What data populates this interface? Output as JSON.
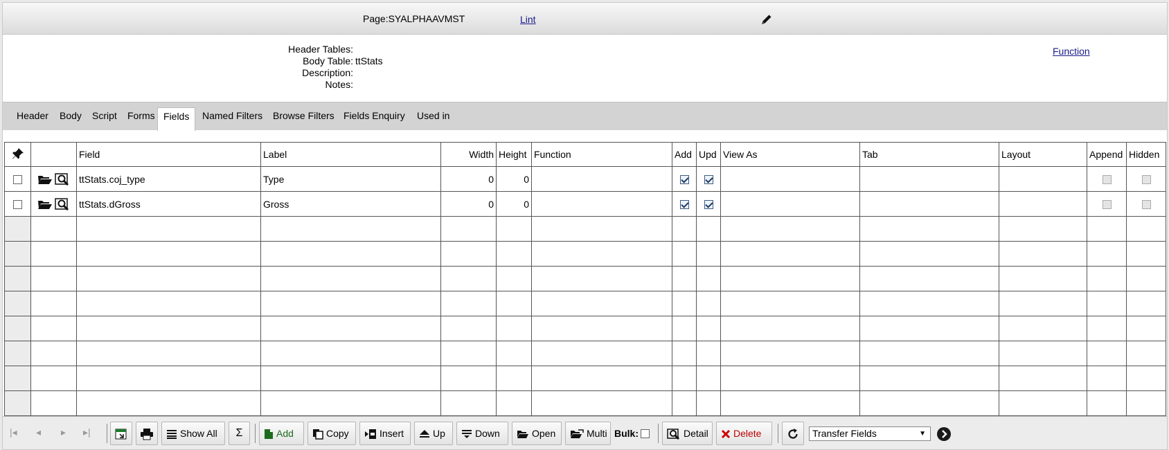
{
  "topbar": {
    "page_label": "Page:SYALPHAAVMST",
    "lint_label": "Lint",
    "edit_icon": "pencil-icon"
  },
  "info": {
    "header_tables_label": "Header Tables:",
    "header_tables_value": "",
    "body_table_label": "Body Table:",
    "body_table_value": "ttStats",
    "description_label": "Description:",
    "description_value": "",
    "notes_label": "Notes:",
    "notes_value": "",
    "function_link": "Function"
  },
  "tabs": [
    {
      "label": "Header"
    },
    {
      "label": "Body"
    },
    {
      "label": "Script"
    },
    {
      "label": "Forms"
    },
    {
      "label": "Fields",
      "active": true
    },
    {
      "label": "Named Filters"
    },
    {
      "label": "Browse Filters"
    },
    {
      "label": "Fields Enquiry"
    },
    {
      "label": "Used in"
    }
  ],
  "grid": {
    "columns": [
      "",
      "",
      "Field",
      "Label",
      "Width",
      "Height",
      "Function",
      "Add",
      "Upd",
      "View As",
      "Tab",
      "Layout",
      "Append",
      "Hidden"
    ],
    "rows": [
      {
        "field": "ttStats.coj_type",
        "label": "Type",
        "width": "0",
        "height": "0",
        "function": "",
        "add": true,
        "upd": true,
        "view_as": "",
        "tab": "",
        "layout": "",
        "append": false,
        "hidden": false
      },
      {
        "field": "ttStats.dGross",
        "label": "Gross",
        "width": "0",
        "height": "0",
        "function": "",
        "add": true,
        "upd": true,
        "view_as": "",
        "tab": "",
        "layout": "",
        "append": false,
        "hidden": false
      }
    ]
  },
  "toolbar": {
    "nav_first": "|◂",
    "nav_prev": "◂",
    "nav_next": "▸",
    "nav_last": "▸|",
    "show_all": "Show All",
    "sum": "Σ",
    "add": "Add",
    "copy": "Copy",
    "insert": "Insert",
    "up": "Up",
    "down": "Down",
    "open": "Open",
    "multi": "Multi",
    "bulk": "Bulk:",
    "detail": "Detail",
    "delete": "Delete",
    "transfer_select": "Transfer Fields"
  }
}
